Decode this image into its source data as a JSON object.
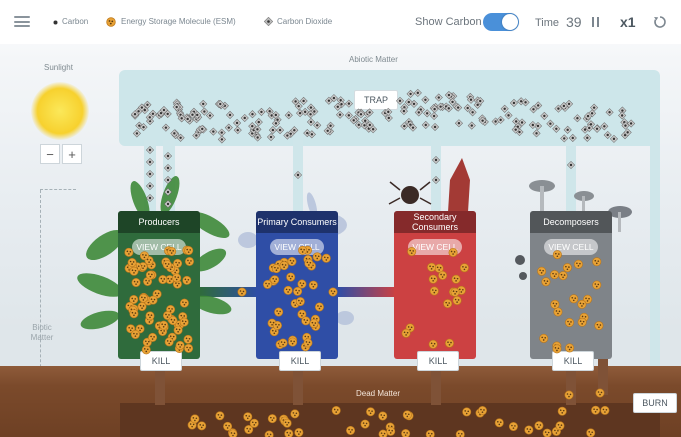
{
  "legend": {
    "carbon": "Carbon",
    "esm": "Energy Storage Molecule (ESM)",
    "co2": "Carbon Dioxide"
  },
  "controls": {
    "show_carbon": "Show Carbon",
    "show_carbon_on": true,
    "time_label": "Time",
    "time_value": "39",
    "speed": "x1"
  },
  "scene": {
    "abiotic": "Abiotic Matter",
    "sunlight": "Sunlight",
    "trap": "TRAP",
    "zoom_out": "−",
    "zoom_in": "+",
    "biotic": "Biotic Matter",
    "dead_matter": "Dead Matter",
    "burn": "BURN"
  },
  "organisms": [
    {
      "title": "Producers",
      "view": "VIEW CELL",
      "kill": "KILL",
      "color": "#2f6b3c"
    },
    {
      "title": "Primary Consumers",
      "view": "VIEW CELL",
      "kill": "KILL",
      "color": "#2f4ea6"
    },
    {
      "title": "Secondary Consumers",
      "view": "VIEW CELL",
      "kill": "KILL",
      "color": "#cc4142"
    },
    {
      "title": "Decomposers",
      "view": "VIEW CELL",
      "kill": "KILL",
      "color": "#7f8489"
    }
  ],
  "colors": {
    "accent": "#4a90d9",
    "esm": "#e8a236",
    "co2": "#555555",
    "pipe": "#cfe6ea",
    "soil": "#7b4a2b"
  },
  "icons": {
    "menu": "hamburger-icon",
    "pause": "pause-icon",
    "reset": "reset-icon"
  }
}
